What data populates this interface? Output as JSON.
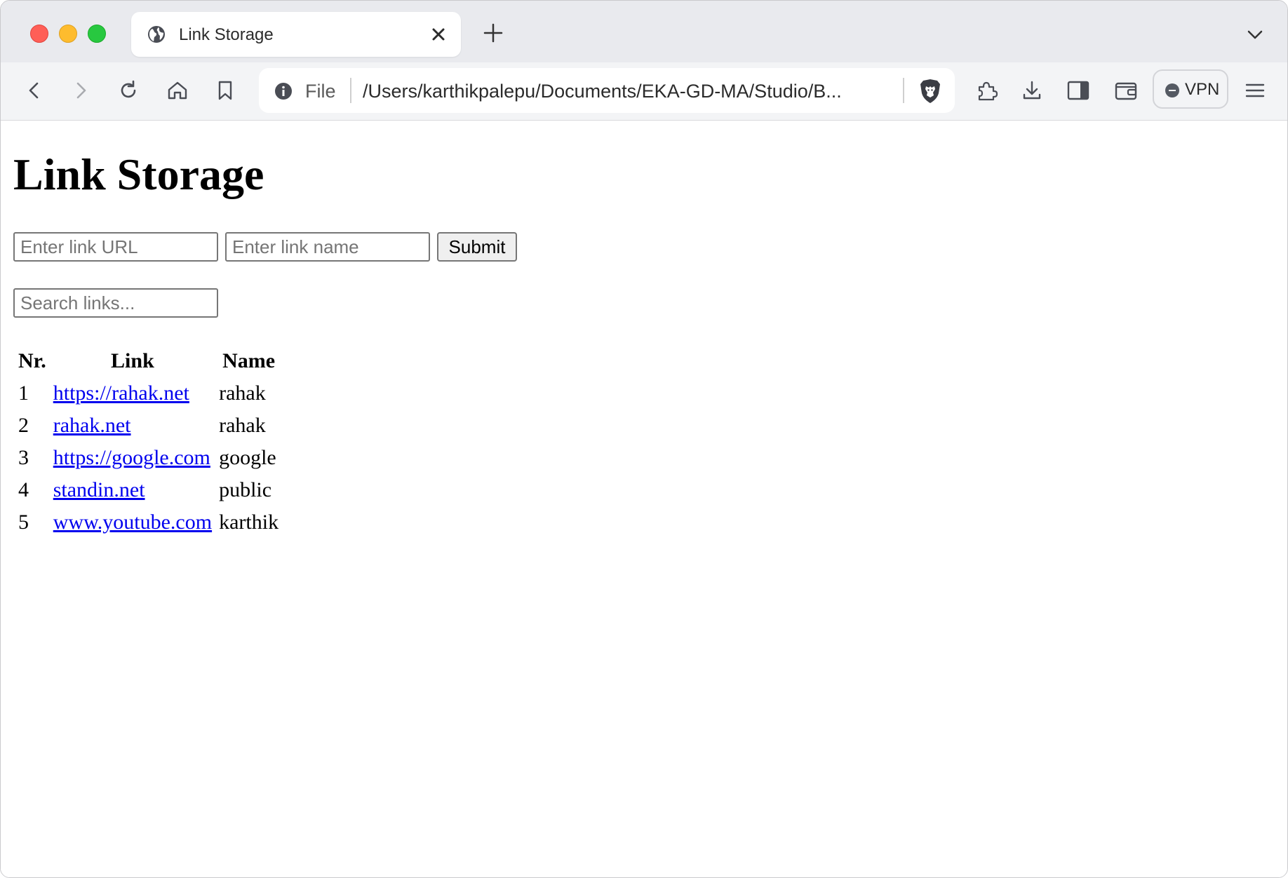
{
  "browser": {
    "tab_title": "Link Storage",
    "url_scheme": "File",
    "url_path": "/Users/karthikpalepu/Documents/EKA-GD-MA/Studio/B...",
    "vpn_label": "VPN"
  },
  "page": {
    "title": "Link Storage",
    "url_input_placeholder": "Enter link URL",
    "name_input_placeholder": "Enter link name",
    "submit_label": "Submit",
    "search_placeholder": "Search links..."
  },
  "table": {
    "headers": [
      "Nr.",
      "Link",
      "Name"
    ],
    "rows": [
      {
        "nr": "1",
        "link": "https://rahak.net",
        "name": "rahak"
      },
      {
        "nr": "2",
        "link": "rahak.net",
        "name": "rahak"
      },
      {
        "nr": "3",
        "link": "https://google.com",
        "name": "google"
      },
      {
        "nr": "4",
        "link": "standin.net",
        "name": "public"
      },
      {
        "nr": "5",
        "link": "www.youtube.com",
        "name": "karthik"
      }
    ]
  },
  "colors": {
    "link": "#0000ee",
    "traffic_red": "#ff5f57",
    "traffic_yellow": "#febc2e",
    "traffic_green": "#28c840"
  }
}
